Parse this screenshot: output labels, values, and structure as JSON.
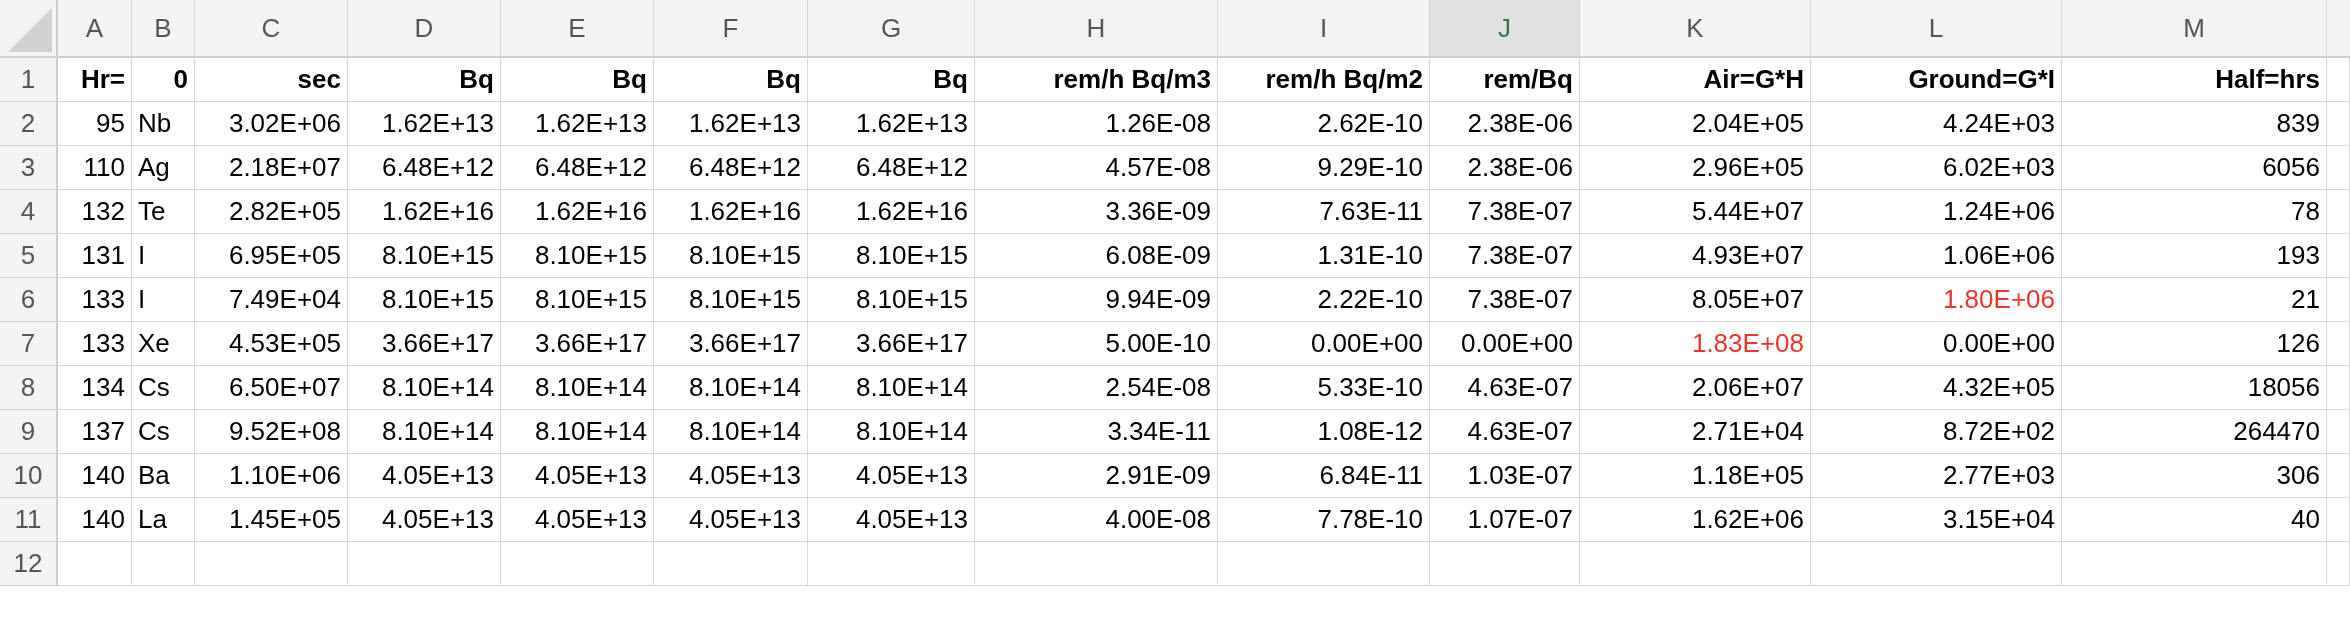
{
  "columns": [
    {
      "letter": "A",
      "selected": false,
      "kind": "number"
    },
    {
      "letter": "B",
      "selected": false,
      "kind": "text"
    },
    {
      "letter": "C",
      "selected": false,
      "kind": "number"
    },
    {
      "letter": "D",
      "selected": false,
      "kind": "number"
    },
    {
      "letter": "E",
      "selected": false,
      "kind": "number"
    },
    {
      "letter": "F",
      "selected": false,
      "kind": "number"
    },
    {
      "letter": "G",
      "selected": false,
      "kind": "number"
    },
    {
      "letter": "H",
      "selected": false,
      "kind": "number"
    },
    {
      "letter": "I",
      "selected": false,
      "kind": "number"
    },
    {
      "letter": "J",
      "selected": true,
      "kind": "number"
    },
    {
      "letter": "K",
      "selected": false,
      "kind": "number"
    },
    {
      "letter": "L",
      "selected": false,
      "kind": "number"
    },
    {
      "letter": "M",
      "selected": false,
      "kind": "number"
    }
  ],
  "rows": [
    {
      "number": "1",
      "kind": "header",
      "cells": [
        {
          "text": "Hr="
        },
        {
          "text": "0"
        },
        {
          "text": "sec"
        },
        {
          "text": "Bq"
        },
        {
          "text": "Bq"
        },
        {
          "text": "Bq"
        },
        {
          "text": "Bq"
        },
        {
          "text": "rem/h Bq/m3"
        },
        {
          "text": "rem/h Bq/m2"
        },
        {
          "text": "rem/Bq"
        },
        {
          "text": "Air=G*H"
        },
        {
          "text": "Ground=G*I"
        },
        {
          "text": "Half=hrs"
        }
      ]
    },
    {
      "number": "2",
      "kind": "data",
      "cells": [
        {
          "text": "95"
        },
        {
          "text": "Nb"
        },
        {
          "text": "3.02E+06"
        },
        {
          "text": "1.62E+13"
        },
        {
          "text": "1.62E+13"
        },
        {
          "text": "1.62E+13"
        },
        {
          "text": "1.62E+13"
        },
        {
          "text": "1.26E-08"
        },
        {
          "text": "2.62E-10"
        },
        {
          "text": "2.38E-06"
        },
        {
          "text": "2.04E+05"
        },
        {
          "text": "4.24E+03"
        },
        {
          "text": "839"
        }
      ]
    },
    {
      "number": "3",
      "kind": "data",
      "cells": [
        {
          "text": "110"
        },
        {
          "text": "Ag"
        },
        {
          "text": "2.18E+07"
        },
        {
          "text": "6.48E+12"
        },
        {
          "text": "6.48E+12"
        },
        {
          "text": "6.48E+12"
        },
        {
          "text": "6.48E+12"
        },
        {
          "text": "4.57E-08"
        },
        {
          "text": "9.29E-10"
        },
        {
          "text": "2.38E-06"
        },
        {
          "text": "2.96E+05"
        },
        {
          "text": "6.02E+03"
        },
        {
          "text": "6056"
        }
      ]
    },
    {
      "number": "4",
      "kind": "data",
      "cells": [
        {
          "text": "132"
        },
        {
          "text": "Te"
        },
        {
          "text": "2.82E+05"
        },
        {
          "text": "1.62E+16"
        },
        {
          "text": "1.62E+16"
        },
        {
          "text": "1.62E+16"
        },
        {
          "text": "1.62E+16"
        },
        {
          "text": "3.36E-09"
        },
        {
          "text": "7.63E-11"
        },
        {
          "text": "7.38E-07"
        },
        {
          "text": "5.44E+07"
        },
        {
          "text": "1.24E+06"
        },
        {
          "text": "78"
        }
      ]
    },
    {
      "number": "5",
      "kind": "data",
      "cells": [
        {
          "text": "131"
        },
        {
          "text": "I"
        },
        {
          "text": "6.95E+05"
        },
        {
          "text": "8.10E+15"
        },
        {
          "text": "8.10E+15"
        },
        {
          "text": "8.10E+15"
        },
        {
          "text": "8.10E+15"
        },
        {
          "text": "6.08E-09"
        },
        {
          "text": "1.31E-10"
        },
        {
          "text": "7.38E-07"
        },
        {
          "text": "4.93E+07"
        },
        {
          "text": "1.06E+06"
        },
        {
          "text": "193"
        }
      ]
    },
    {
      "number": "6",
      "kind": "data",
      "cells": [
        {
          "text": "133"
        },
        {
          "text": "I"
        },
        {
          "text": "7.49E+04"
        },
        {
          "text": "8.10E+15"
        },
        {
          "text": "8.10E+15"
        },
        {
          "text": "8.10E+15"
        },
        {
          "text": "8.10E+15"
        },
        {
          "text": "9.94E-09"
        },
        {
          "text": "2.22E-10"
        },
        {
          "text": "7.38E-07"
        },
        {
          "text": "8.05E+07"
        },
        {
          "text": "1.80E+06",
          "color": "#e8382c"
        },
        {
          "text": "21"
        }
      ]
    },
    {
      "number": "7",
      "kind": "data",
      "cells": [
        {
          "text": "133"
        },
        {
          "text": "Xe"
        },
        {
          "text": "4.53E+05"
        },
        {
          "text": "3.66E+17"
        },
        {
          "text": "3.66E+17"
        },
        {
          "text": "3.66E+17"
        },
        {
          "text": "3.66E+17"
        },
        {
          "text": "5.00E-10"
        },
        {
          "text": "0.00E+00"
        },
        {
          "text": "0.00E+00"
        },
        {
          "text": "1.83E+08",
          "color": "#e8382c"
        },
        {
          "text": "0.00E+00"
        },
        {
          "text": "126"
        }
      ]
    },
    {
      "number": "8",
      "kind": "data",
      "cells": [
        {
          "text": "134"
        },
        {
          "text": "Cs"
        },
        {
          "text": "6.50E+07"
        },
        {
          "text": "8.10E+14"
        },
        {
          "text": "8.10E+14"
        },
        {
          "text": "8.10E+14"
        },
        {
          "text": "8.10E+14"
        },
        {
          "text": "2.54E-08"
        },
        {
          "text": "5.33E-10"
        },
        {
          "text": "4.63E-07"
        },
        {
          "text": "2.06E+07"
        },
        {
          "text": "4.32E+05"
        },
        {
          "text": "18056"
        }
      ]
    },
    {
      "number": "9",
      "kind": "data",
      "cells": [
        {
          "text": "137"
        },
        {
          "text": "Cs"
        },
        {
          "text": "9.52E+08"
        },
        {
          "text": "8.10E+14"
        },
        {
          "text": "8.10E+14"
        },
        {
          "text": "8.10E+14"
        },
        {
          "text": "8.10E+14"
        },
        {
          "text": "3.34E-11"
        },
        {
          "text": "1.08E-12"
        },
        {
          "text": "4.63E-07"
        },
        {
          "text": "2.71E+04"
        },
        {
          "text": "8.72E+02"
        },
        {
          "text": "264470"
        }
      ]
    },
    {
      "number": "10",
      "kind": "data",
      "cells": [
        {
          "text": "140"
        },
        {
          "text": "Ba"
        },
        {
          "text": "1.10E+06"
        },
        {
          "text": "4.05E+13"
        },
        {
          "text": "4.05E+13"
        },
        {
          "text": "4.05E+13"
        },
        {
          "text": "4.05E+13"
        },
        {
          "text": "2.91E-09"
        },
        {
          "text": "6.84E-11"
        },
        {
          "text": "1.03E-07"
        },
        {
          "text": "1.18E+05"
        },
        {
          "text": "2.77E+03"
        },
        {
          "text": "306"
        }
      ]
    },
    {
      "number": "11",
      "kind": "data",
      "cells": [
        {
          "text": "140"
        },
        {
          "text": "La"
        },
        {
          "text": "1.45E+05"
        },
        {
          "text": "4.05E+13"
        },
        {
          "text": "4.05E+13"
        },
        {
          "text": "4.05E+13"
        },
        {
          "text": "4.05E+13"
        },
        {
          "text": "4.00E-08"
        },
        {
          "text": "7.78E-10"
        },
        {
          "text": "1.07E-07"
        },
        {
          "text": "1.62E+06"
        },
        {
          "text": "3.15E+04"
        },
        {
          "text": "40"
        }
      ]
    },
    {
      "number": "12",
      "kind": "data",
      "cells": []
    }
  ]
}
